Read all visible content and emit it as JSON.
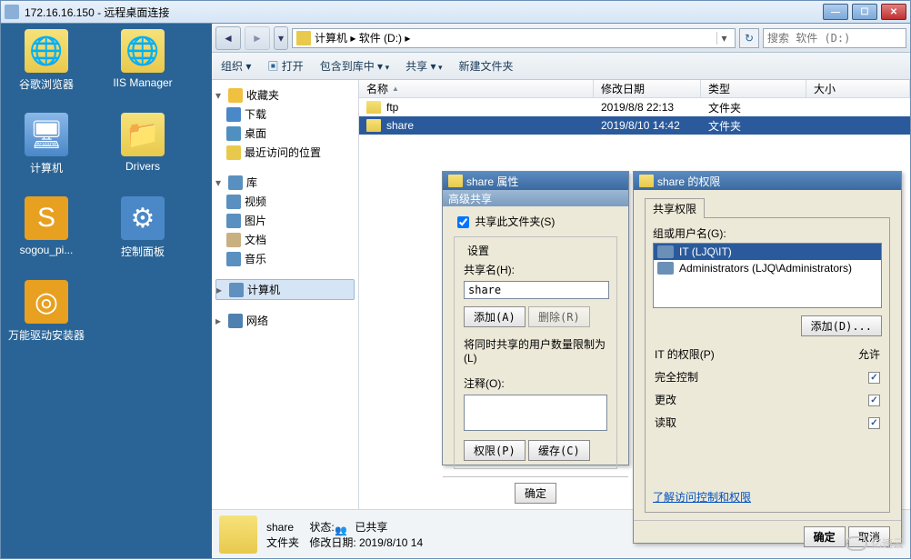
{
  "window": {
    "title": "172.16.16.150 - 远程桌面连接"
  },
  "desktop": {
    "icons": [
      {
        "label": "谷歌浏览器",
        "glyph": "folder-glyph"
      },
      {
        "label": "IIS Manager",
        "glyph": "folder-glyph"
      },
      {
        "label": "计算机",
        "glyph": "pc-glyph"
      },
      {
        "label": "Drivers",
        "glyph": "folder-glyph"
      },
      {
        "label": "sogou_pi...",
        "glyph": "driver-glyph"
      },
      {
        "label": "控制面板",
        "glyph": "panel-glyph"
      },
      {
        "label": "万能驱动安装器",
        "glyph": "driver-glyph"
      }
    ]
  },
  "explorer": {
    "address": "计算机 ▸ 软件 (D:) ▸",
    "search_placeholder": "搜索 软件 (D:)",
    "commands": {
      "org": "组织 ▾",
      "open": "打开",
      "include": "包含到库中 ▾",
      "share": "共享 ▾",
      "newfolder": "新建文件夹"
    },
    "tree": {
      "fav": "收藏夹",
      "dl": "下载",
      "desktop": "桌面",
      "recent": "最近访问的位置",
      "lib": "库",
      "video": "视频",
      "pic": "图片",
      "doc": "文档",
      "music": "音乐",
      "pc": "计算机",
      "net": "网络"
    },
    "columns": {
      "name": "名称",
      "date": "修改日期",
      "type": "类型",
      "size": "大小"
    },
    "rows": [
      {
        "name": "ftp",
        "date": "2019/8/8 22:13",
        "type": "文件夹"
      },
      {
        "name": "share",
        "date": "2019/8/10 14:42",
        "type": "文件夹"
      }
    ],
    "status": {
      "name": "share",
      "state_label": "状态:",
      "state": "已共享",
      "type": "文件夹",
      "date_label": "修改日期:",
      "date": "2019/8/10 14"
    }
  },
  "dlg_props": {
    "title": "share 属性",
    "subtitle": "高级共享",
    "share_cb": "共享此文件夹(S)",
    "settings": "设置",
    "sharename_label": "共享名(H):",
    "sharename_value": "share",
    "add": "添加(A)",
    "remove": "删除(R)",
    "limit": "将同时共享的用户数量限制为(L)",
    "comment": "注释(O):",
    "perm": "权限(P)",
    "cache": "缓存(C)",
    "ok": "确定"
  },
  "dlg_perm": {
    "title": "share 的权限",
    "tab": "共享权限",
    "group_label": "组或用户名(G):",
    "users": [
      {
        "name": "IT (LJQ\\IT)",
        "sel": true
      },
      {
        "name": "Administrators (LJQ\\Administrators)",
        "sel": false
      }
    ],
    "add": "添加(D)...",
    "perm_header_left": "IT 的权限(P)",
    "perm_header_right": "允许",
    "perms": [
      {
        "label": "完全控制",
        "allow": true
      },
      {
        "label": "更改",
        "allow": true
      },
      {
        "label": "读取",
        "allow": true
      }
    ],
    "link": "了解访问控制和权限",
    "ok": "确定",
    "cancel": "取消"
  },
  "watermark": "亿速云"
}
